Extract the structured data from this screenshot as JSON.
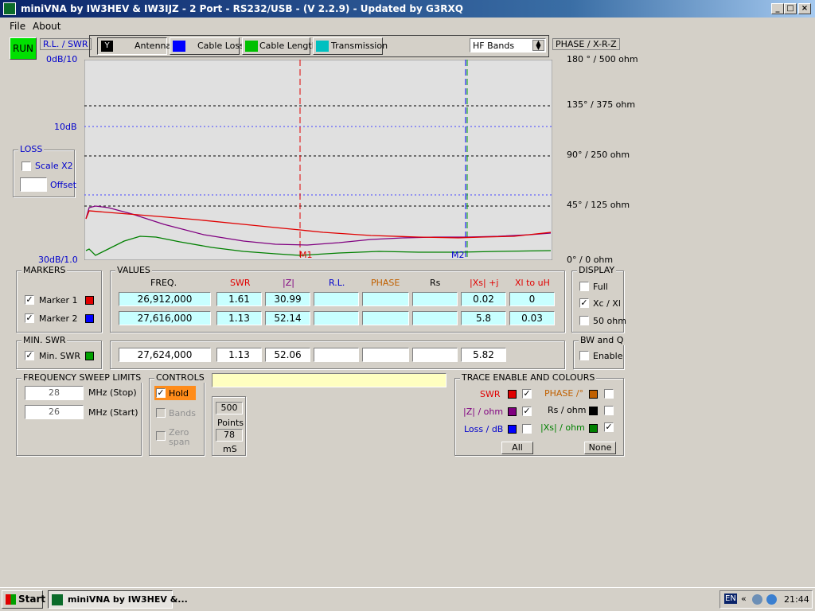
{
  "window": {
    "title": "miniVNA by IW3HEV & IW3IJZ - 2 Port - RS232/USB -  (V 2.2.9) - Updated by G3RXQ"
  },
  "menu": [
    "File",
    "About"
  ],
  "run_label": "RUN",
  "left_header": "R.L. / SWR",
  "right_header": "PHASE / X-R-Z",
  "modes": [
    "Antenna",
    "Cable Loss",
    "Cable Length",
    "Transmission"
  ],
  "band_select": "HF Bands",
  "left_axis": {
    "top": "0dB/10",
    "mid": "10dB",
    "bottom": "30dB/1.0"
  },
  "right_axis": [
    "180 ° / 500 ohm",
    "135° / 375 ohm",
    "90° / 250 ohm",
    "45° / 125 ohm",
    "0° / 0 ohm"
  ],
  "loss": {
    "title": "LOSS",
    "scale": "Scale X2",
    "offset": "Offset"
  },
  "plot_markers": [
    "M1",
    "M2"
  ],
  "markers": {
    "title": "MARKERS",
    "m1": "Marker 1",
    "m2": "Marker 2"
  },
  "values": {
    "title": "VALUES",
    "headers": [
      "FREQ.",
      "SWR",
      "|Z|",
      "R.L.",
      "PHASE",
      "Rs",
      "|Xs| +j",
      "Xl to uH"
    ],
    "row1": [
      "26,912,000",
      "1.61",
      "30.99",
      "",
      "",
      "",
      "0.02",
      "0"
    ],
    "row2": [
      "27,616,000",
      "1.13",
      "52.14",
      "",
      "",
      "",
      "5.8",
      "0.03"
    ]
  },
  "min_swr": {
    "title": "MIN. SWR",
    "label": "Min. SWR",
    "row": [
      "27,624,000",
      "1.13",
      "52.06",
      "",
      "",
      "5.82"
    ]
  },
  "display": {
    "title": "DISPLAY",
    "items": [
      "Full",
      "Xc / Xl",
      "50 ohm"
    ]
  },
  "bwq": {
    "title": "BW and Q",
    "enable": "Enable"
  },
  "sweep": {
    "title": "FREQUENCY SWEEP LIMITS",
    "stop": "28",
    "stop_label": "MHz (Stop)",
    "start": "26",
    "start_label": "MHz (Start)"
  },
  "controls": {
    "title": "CONTROLS",
    "hold": "Hold",
    "bands": "Bands",
    "zero": "Zero",
    "span": "span",
    "points_val": "500",
    "points": "Points",
    "ms_val": "78",
    "ms": "mS"
  },
  "trace": {
    "title": "TRACE ENABLE AND COLOURS",
    "swr": "SWR",
    "phase": "PHASE /°",
    "z": "|Z| / ohm",
    "rs": "Rs / ohm",
    "loss": "Loss / dB",
    "xs": "|Xs| / ohm",
    "all": "All",
    "none": "None"
  },
  "colors": {
    "swr": "#e00000",
    "z": "#800080",
    "loss": "#0000ff",
    "phase": "#c06000",
    "rs": "#000000",
    "xs": "#008000"
  },
  "taskbar": {
    "start": "Start",
    "task": "miniVNA by IW3HEV &...",
    "lang": "EN",
    "time": "21:44"
  }
}
